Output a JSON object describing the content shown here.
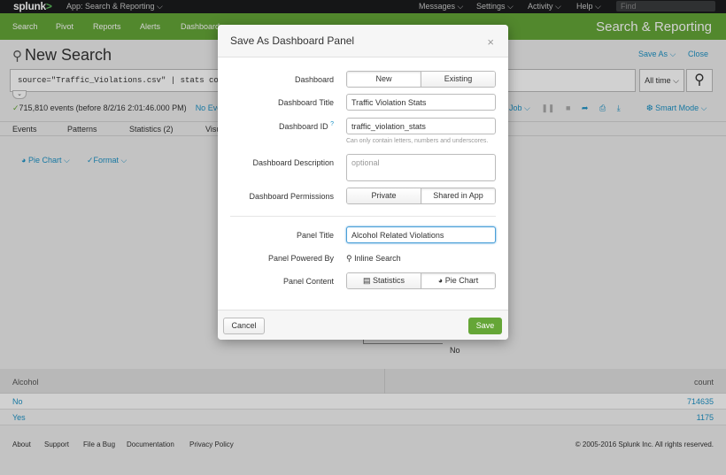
{
  "topbar": {
    "logo": "splunk",
    "logo_suffix": ">",
    "app": "App: Search & Reporting ⌵",
    "menus": [
      "Messages ⌵",
      "Settings ⌵",
      "Activity ⌵",
      "Help ⌵"
    ],
    "find_placeholder": "Find"
  },
  "appbar": {
    "nav": [
      "Search",
      "Pivot",
      "Reports",
      "Alerts",
      "Dashboards"
    ],
    "app_title": "Search & Reporting"
  },
  "search": {
    "title": "New Search",
    "save_as": "Save As ⌵",
    "close": "Close",
    "query": "source=\"Traffic_Violations.csv\" |  stats count by Alcohol",
    "time_range": "All time ⌵",
    "events_summary": "715,810 events (before 8/2/16 2:01:46.000 PM)",
    "events_link": "No Event Sampling ⌵",
    "job_label": "Job ⌵",
    "smart_mode": "Smart Mode ⌵"
  },
  "tabs": [
    "Events",
    "Patterns",
    "Statistics (2)",
    "Visualization"
  ],
  "viz": {
    "pie_chart_link": "Pie Chart ⌵",
    "format_link": "Format ⌵",
    "pie_label": "No"
  },
  "results": {
    "columns": [
      "Alcohol",
      "count"
    ],
    "rows": [
      {
        "alcohol": "No",
        "count": "714635"
      },
      {
        "alcohol": "Yes",
        "count": "1175"
      }
    ]
  },
  "footer": {
    "links": [
      "About",
      "Support",
      "File a Bug",
      "Documentation",
      "Privacy Policy"
    ],
    "copyright": "© 2005-2016 Splunk Inc. All rights reserved."
  },
  "modal": {
    "title": "Save As Dashboard Panel",
    "close": "×",
    "dashboard_label": "Dashboard",
    "dashboard_options": [
      "New",
      "Existing"
    ],
    "dashboard_title_label": "Dashboard Title",
    "dashboard_title_value": "Traffic Violation Stats",
    "dashboard_id_label": "Dashboard ID",
    "dashboard_id_help_mark": "?",
    "dashboard_id_value": "traffic_violation_stats",
    "dashboard_id_help": "Can only contain letters, numbers and underscores.",
    "description_label": "Dashboard Description",
    "description_placeholder": "optional",
    "permissions_label": "Dashboard Permissions",
    "permissions_options": [
      "Private",
      "Shared in App"
    ],
    "panel_title_label": "Panel Title",
    "panel_title_value": "Alcohol Related Violations",
    "powered_by_label": "Panel Powered By",
    "powered_by_value": "Inline Search",
    "content_label": "Panel Content",
    "content_options": [
      "Statistics",
      "Pie Chart"
    ],
    "cancel": "Cancel",
    "save": "Save"
  }
}
